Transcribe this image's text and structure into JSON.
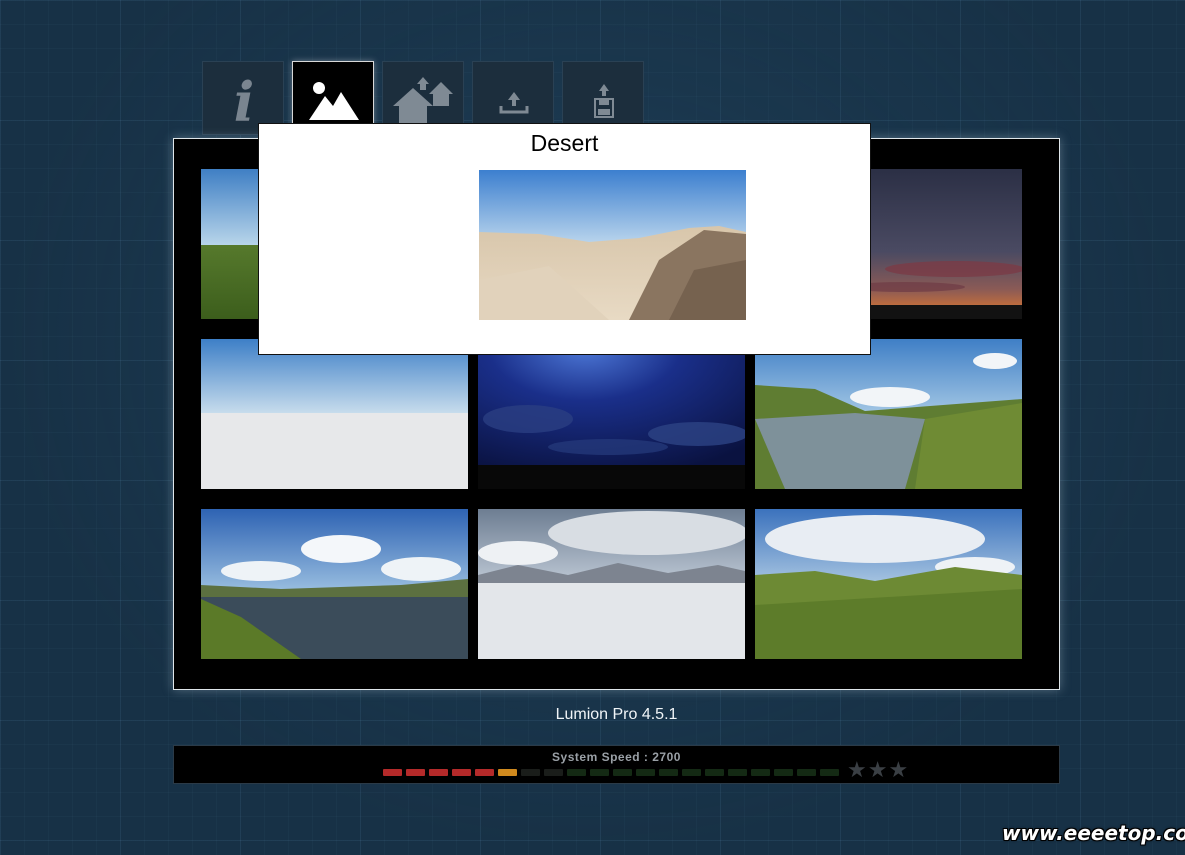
{
  "toolbar": {
    "buttons": [
      {
        "id": "info",
        "icon": "info-icon",
        "glyph": "i",
        "active": false
      },
      {
        "id": "landscape",
        "icon": "landscape-icon",
        "active": true
      },
      {
        "id": "houses",
        "icon": "houses-icon",
        "active": false
      },
      {
        "id": "load",
        "icon": "upload-tray-icon",
        "active": false
      },
      {
        "id": "save",
        "icon": "save-floppy-icon",
        "active": false
      }
    ]
  },
  "scenes": [
    {
      "id": "grass-plain",
      "icon": "scene-grass-plain"
    },
    {
      "id": "desert",
      "icon": "scene-desert"
    },
    {
      "id": "sunset",
      "icon": "scene-sunset"
    },
    {
      "id": "white-plain",
      "icon": "scene-white-plain"
    },
    {
      "id": "night-sky",
      "icon": "scene-night"
    },
    {
      "id": "river-valley",
      "icon": "scene-river-valley"
    },
    {
      "id": "lake-coast",
      "icon": "scene-lake-coast"
    },
    {
      "id": "snow-plain",
      "icon": "scene-snow-plain"
    },
    {
      "id": "green-hills",
      "icon": "scene-green-hills"
    }
  ],
  "tooltip": {
    "title": "Desert",
    "preview_icon": "scene-desert"
  },
  "version": "Lumion Pro 4.5.1",
  "speed": {
    "label": "System Speed : 2700",
    "level_segments_lit": 6,
    "total_segments": 20,
    "stars_total": 3,
    "stars_lit": 0
  },
  "watermark": "www.eeeetop.com",
  "colors": {
    "meter_red": "#b42a2a",
    "meter_orange": "#d08a1e",
    "meter_off_dark": "#1a1d1a",
    "meter_off_green": "#142a14"
  }
}
